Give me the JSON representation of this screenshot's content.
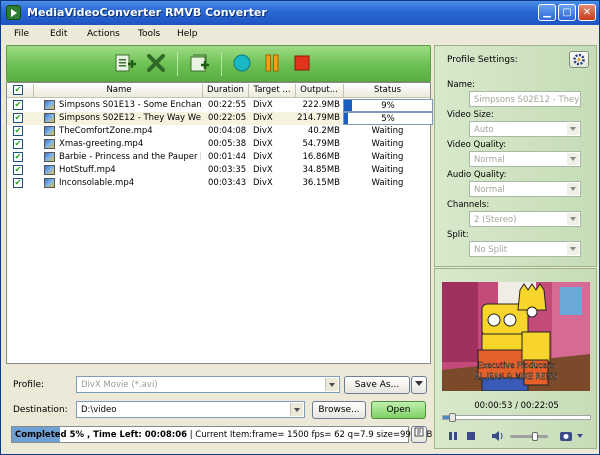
{
  "window": {
    "title": "MediaVideoConverter RMVB Converter",
    "minimize_glyph": "▁",
    "maximize_glyph": "▢",
    "close_glyph": "✕"
  },
  "menu": [
    "File",
    "Edit",
    "Actions",
    "Tools",
    "Help"
  ],
  "toolbar": {
    "icons": [
      "add-file-icon",
      "remove-icon",
      "import-icon",
      "convert-icon",
      "pause-icon",
      "stop-icon"
    ],
    "colors": {
      "bar": "#6fc255",
      "convert": "#19b8c2",
      "pause": "#f0a010",
      "stop": "#e2331c"
    }
  },
  "table": {
    "columns": [
      "Name",
      "Duration",
      "Target ...",
      "Output...",
      "Status"
    ],
    "rows": [
      {
        "name": "Simpsons S01E13 - Some Enchant...",
        "duration": "00:22:55",
        "target": "DivX",
        "output": "222.9MB",
        "status": "9%",
        "progress": 0.09
      },
      {
        "name": "Simpsons S02E12 - They Way We ...",
        "duration": "00:22:05",
        "target": "DivX",
        "output": "214.79MB",
        "status": "5%",
        "progress": 0.05
      },
      {
        "name": "TheComfortZone.mp4",
        "duration": "00:04:08",
        "target": "DivX",
        "output": "40.2MB",
        "status": "Waiting"
      },
      {
        "name": "Xmas-greeting.mp4",
        "duration": "00:05:38",
        "target": "DivX",
        "output": "54.79MB",
        "status": "Waiting"
      },
      {
        "name": "Barbie - Princess and the Pauper [...",
        "duration": "00:01:44",
        "target": "DivX",
        "output": "16.86MB",
        "status": "Waiting"
      },
      {
        "name": "HotStuff.mp4",
        "duration": "00:03:35",
        "target": "DivX",
        "output": "34.85MB",
        "status": "Waiting"
      },
      {
        "name": "Inconsolable.mp4",
        "duration": "00:03:43",
        "target": "DivX",
        "output": "36.15MB",
        "status": "Waiting"
      }
    ]
  },
  "profile": {
    "label": "Profile:",
    "value": "DivX Movie (*.avi)",
    "save_as": "Save As..."
  },
  "destination": {
    "label": "Destination:",
    "value": "D:\\video",
    "browse": "Browse...",
    "open": "Open"
  },
  "status_bar": {
    "bold_text": "Completed 5% , Time Left: 00:08:06",
    "detail_text": " | Current Item:frame= 1500 fps= 62 q=7.9 size=9963kB t..."
  },
  "settings": {
    "title": "Profile Settings:",
    "fields": [
      {
        "label": "Name:",
        "value": "Simpsons S02E12 - They Way"
      },
      {
        "label": "Video Size:",
        "value": "Auto"
      },
      {
        "label": "Video Quality:",
        "value": "Normal"
      },
      {
        "label": "Audio Quality:",
        "value": "Normal"
      },
      {
        "label": "Channels:",
        "value": "2 (Stereo)"
      },
      {
        "label": "Split:",
        "value": "No Split"
      }
    ]
  },
  "player": {
    "time": "00:00:53 / 00:22:05",
    "seek_position": 0.04,
    "volume_level": 0.7,
    "subtitle_line1": "Executive Producers",
    "subtitle_line2": "AL JEAN & MIKE REISS"
  }
}
